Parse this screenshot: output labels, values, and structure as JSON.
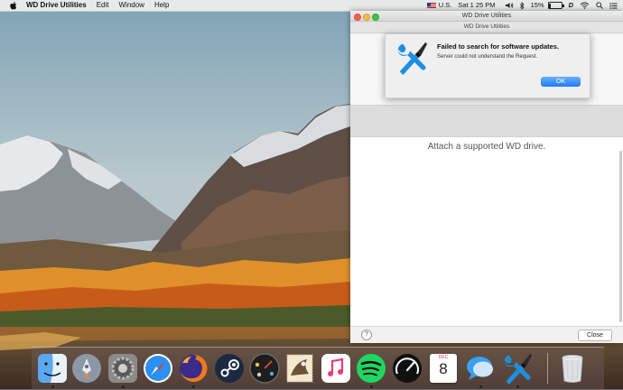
{
  "menubar": {
    "app_name": "WD Drive Utilities",
    "menus": [
      "Edit",
      "Window",
      "Help"
    ],
    "input_source": "U.S.",
    "clock": "Sat 1 25 PM",
    "battery_percent": "15%",
    "battery_level": 0.15,
    "status_letter": "D"
  },
  "window": {
    "title": "WD Drive Utilities",
    "subtitle": "WD Drive Utilities",
    "empty_message": "Attach a supported WD drive.",
    "help_label": "?",
    "close_label": "Close"
  },
  "alert": {
    "title": "Failed to search for software updates.",
    "message": "Server could not understand the Request.",
    "ok_label": "OK"
  },
  "dock": {
    "items": [
      "finder-icon",
      "launchpad-icon",
      "system-preferences-icon",
      "safari-icon",
      "firefox-icon",
      "steam-icon",
      "dashboard-icon",
      "mail-icon",
      "itunes-icon",
      "spotify-icon",
      "speedometer-icon",
      "calendar-icon",
      "messages-icon",
      "wd-utilities-icon",
      "trash-icon"
    ],
    "calendar_month": "DEC",
    "calendar_day": "8"
  },
  "colors": {
    "accent_blue": "#1d7bf0",
    "wd_icon_blue": "#1e8fe0"
  }
}
